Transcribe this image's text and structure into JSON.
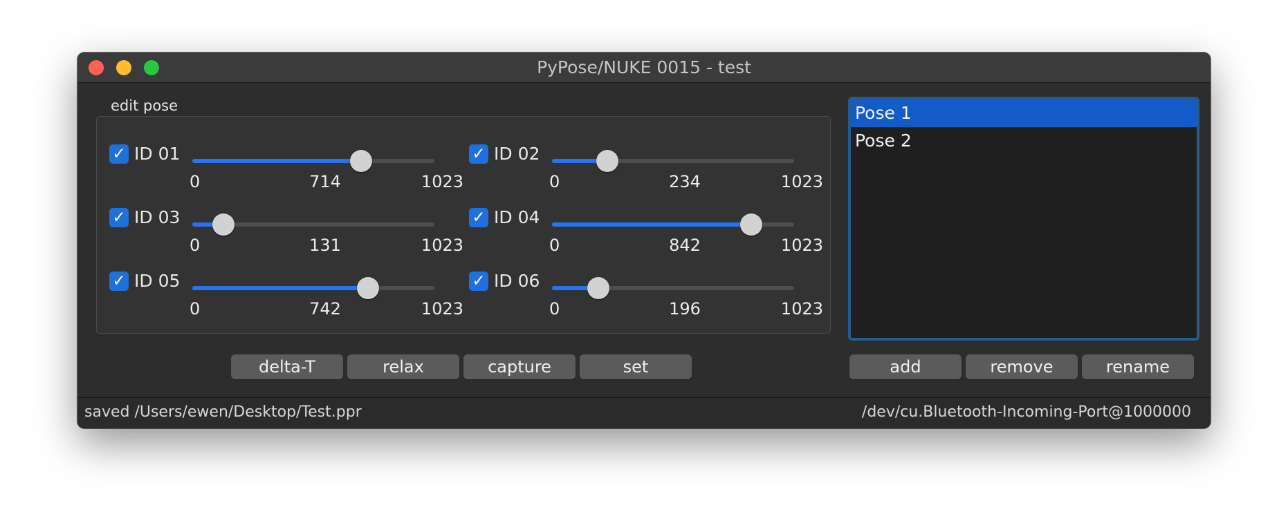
{
  "window": {
    "title": "PyPose/NUKE 0015 - test"
  },
  "edit_pose": {
    "group_label": "edit pose",
    "joints": [
      {
        "label": "ID 01",
        "checked": true,
        "min": "0",
        "value": "714",
        "max": "1023",
        "level": 714
      },
      {
        "label": "ID 02",
        "checked": true,
        "min": "0",
        "value": "234",
        "max": "1023",
        "level": 234
      },
      {
        "label": "ID 03",
        "checked": true,
        "min": "0",
        "value": "131",
        "max": "1023",
        "level": 131
      },
      {
        "label": "ID 04",
        "checked": true,
        "min": "0",
        "value": "842",
        "max": "1023",
        "level": 842
      },
      {
        "label": "ID 05",
        "checked": true,
        "min": "0",
        "value": "742",
        "max": "1023",
        "level": 742
      },
      {
        "label": "ID 06",
        "checked": true,
        "min": "0",
        "value": "196",
        "max": "1023",
        "level": 196
      }
    ],
    "buttons": [
      "delta-T",
      "relax",
      "capture",
      "set"
    ]
  },
  "poses": {
    "items": [
      "Pose 1",
      "Pose 2"
    ],
    "selected": "Pose 1",
    "buttons": [
      "add",
      "remove",
      "rename"
    ]
  },
  "status": {
    "left": "saved /Users/ewen/Desktop/Test.ppr",
    "right": "/dev/cu.Bluetooth-Incoming-Port@1000000"
  },
  "icons": {
    "checkbox": "checkmark-icon"
  },
  "colors": {
    "accent": "#2874f0",
    "selection": "#115cc9",
    "window_bg": "#2d2d2d"
  }
}
